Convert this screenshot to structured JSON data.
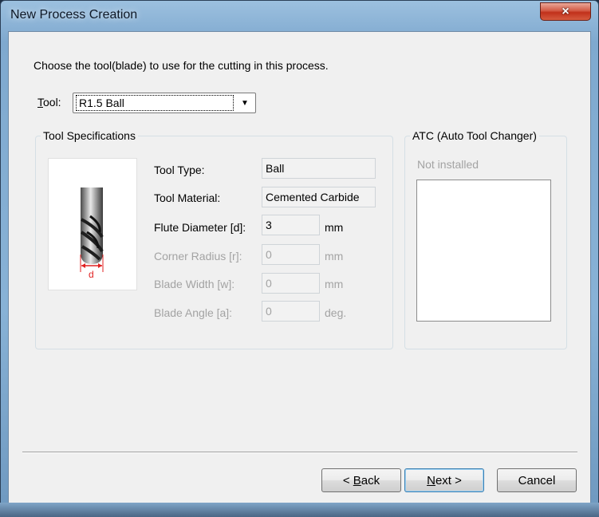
{
  "window": {
    "title": "New Process Creation",
    "close_glyph": "×"
  },
  "instruction": "Choose the tool(blade) to use for the cutting in this process.",
  "tool_select": {
    "label_mnemonic": "T",
    "label_rest": "ool:",
    "value": "R1.5 Ball",
    "arrow": "▼"
  },
  "tool_specs": {
    "legend": "Tool Specifications",
    "fields": {
      "tool_type": {
        "label": "Tool Type:",
        "value": "Ball"
      },
      "tool_material": {
        "label": "Tool Material:",
        "value": "Cemented Carbide"
      },
      "flute_diameter": {
        "label": "Flute Diameter [d]:",
        "value": "3",
        "unit": "mm"
      },
      "corner_radius": {
        "label": "Corner Radius [r]:",
        "value": "0",
        "unit": "mm"
      },
      "blade_width": {
        "label": "Blade Width [w]:",
        "value": "0",
        "unit": "mm"
      },
      "blade_angle": {
        "label": "Blade Angle [a]:",
        "value": "0",
        "unit": "deg."
      }
    },
    "diagram_label": "d"
  },
  "atc": {
    "legend": "ATC (Auto Tool Changer)",
    "status": "Not installed"
  },
  "buttons": {
    "back": {
      "prefix": "< ",
      "mnemonic": "B",
      "rest": "ack"
    },
    "next": {
      "mnemonic": "N",
      "rest": "ext >"
    },
    "cancel": "Cancel"
  },
  "colors": {
    "accent": "#3c7fb1",
    "dimension_red": "#e02020",
    "close_red": "#c1301a"
  }
}
